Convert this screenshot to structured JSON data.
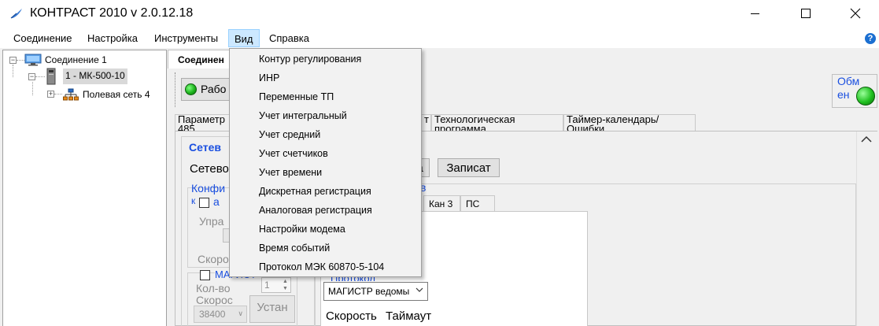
{
  "window": {
    "title": "КОНТРАСТ 2010  v 2.0.12.18",
    "app_icon": "feather-icon",
    "controls": [
      "minimize-icon",
      "maximize-icon",
      "close-icon"
    ]
  },
  "menubar": {
    "items": [
      "Соединение",
      "Настройка",
      "Инструменты",
      "Вид",
      "Справка"
    ],
    "active": "Вид",
    "help_icon": "?"
  },
  "tree": {
    "root": "Соединение 1",
    "device": "1 - МК-500-10",
    "network": "Полевая сеть 4"
  },
  "connection_tab": "Соединен",
  "toolbar": {
    "work_button": "Рабо",
    "exchange_label": "Обм ен"
  },
  "top_tabs": [
    "Параметр 485",
    "т",
    "Технологическая программа",
    "Таймер-календарь/Ошибки"
  ],
  "network_panel": {
    "title": "Сетев",
    "network_label": "Сетево",
    "read_button": "а",
    "write_button": "Записат",
    "config_label": "Конфи",
    "config_label2": "к",
    "master_label": "а",
    "control_label": "Упра",
    "speed_label": "Скоро",
    "magistr_checkbox": "МАГИСТ",
    "count_label": "Кол-во",
    "speed_label2": "Скорос",
    "count_value": "1",
    "speed_value": "38400",
    "set_button": "Устан"
  },
  "channels": {
    "group_title": "в",
    "tabs": [
      "Кан 3",
      "ПС"
    ],
    "protocol_label": "Протокол",
    "protocol_value": "МАГИСТР ведомы",
    "speed_label": "Скорость",
    "timeout_label": "Таймаут"
  },
  "view_menu": {
    "items": [
      "Контур регулирования",
      "ИНР",
      "Переменные ТП",
      "Учет интегральный",
      "Учет средний",
      "Учет счетчиков",
      "Учет времени",
      "Дискретная регистрация",
      "Аналоговая регистрация",
      "Настройки модема",
      "Время событий",
      "Протокол МЭК 60870-5-104"
    ]
  },
  "colors": {
    "accent_blue": "#1a4fe0",
    "led_green": "#20c020",
    "menu_highlight": "#cce8ff"
  }
}
